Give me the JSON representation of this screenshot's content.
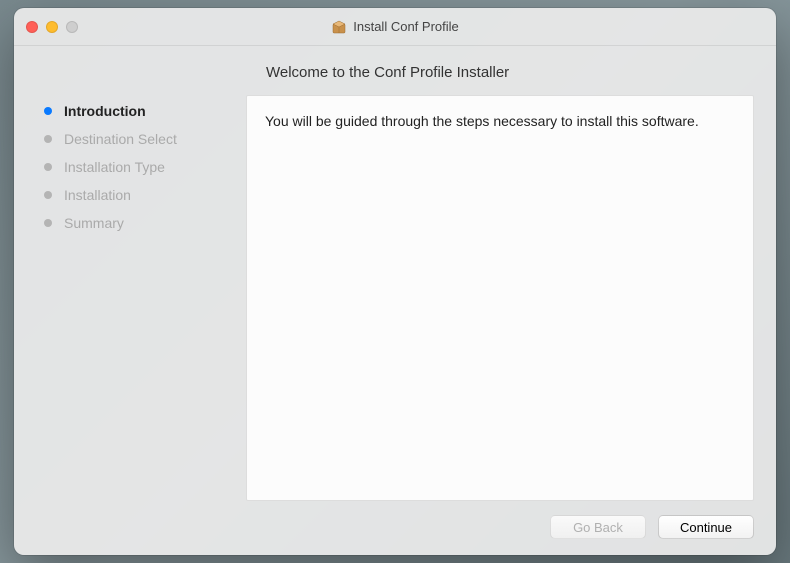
{
  "window": {
    "title": "Install Conf Profile"
  },
  "heading": "Welcome to the Conf Profile Installer",
  "sidebar": {
    "steps": [
      {
        "label": "Introduction",
        "active": true
      },
      {
        "label": "Destination Select",
        "active": false
      },
      {
        "label": "Installation Type",
        "active": false
      },
      {
        "label": "Installation",
        "active": false
      },
      {
        "label": "Summary",
        "active": false
      }
    ]
  },
  "content": {
    "body_text": "You will be guided through the steps necessary to install this software."
  },
  "buttons": {
    "go_back": "Go Back",
    "continue": "Continue"
  }
}
